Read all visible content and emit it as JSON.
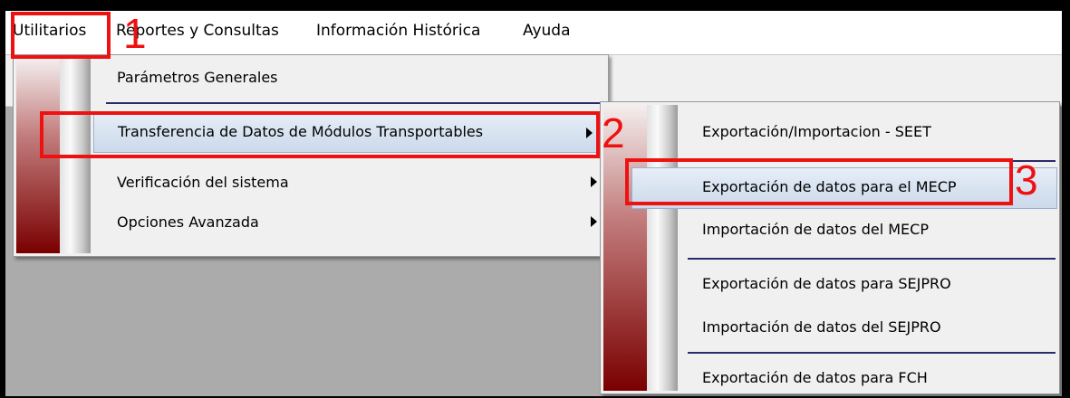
{
  "menubar": {
    "items": [
      {
        "label": "Utilitarios"
      },
      {
        "label": "Reportes y Consultas"
      },
      {
        "label": "Información Histórica"
      },
      {
        "label": "Ayuda"
      }
    ]
  },
  "utilitarios_menu": {
    "items": [
      {
        "label": "Parámetros Generales"
      },
      {
        "label": "Transferencia de Datos de Módulos Transportables"
      },
      {
        "label": "Verificación del sistema"
      },
      {
        "label": "Opciones Avanzada"
      }
    ]
  },
  "submenu": {
    "items": [
      {
        "label": "Exportación/Importacion - SEET"
      },
      {
        "label": "Exportación de datos para el MECP"
      },
      {
        "label": "Importación de datos del MECP"
      },
      {
        "label": "Exportación de datos para SEJPRO"
      },
      {
        "label": "Importación de datos del SEJPRO"
      },
      {
        "label": "Exportación de datos para FCH"
      }
    ]
  },
  "annotations": {
    "step1": "1",
    "step2": "2",
    "step3": "3"
  },
  "colors": {
    "annotation_red": "#ee1111",
    "highlight": "#cbd9ea",
    "separator": "#2a2a6a"
  }
}
